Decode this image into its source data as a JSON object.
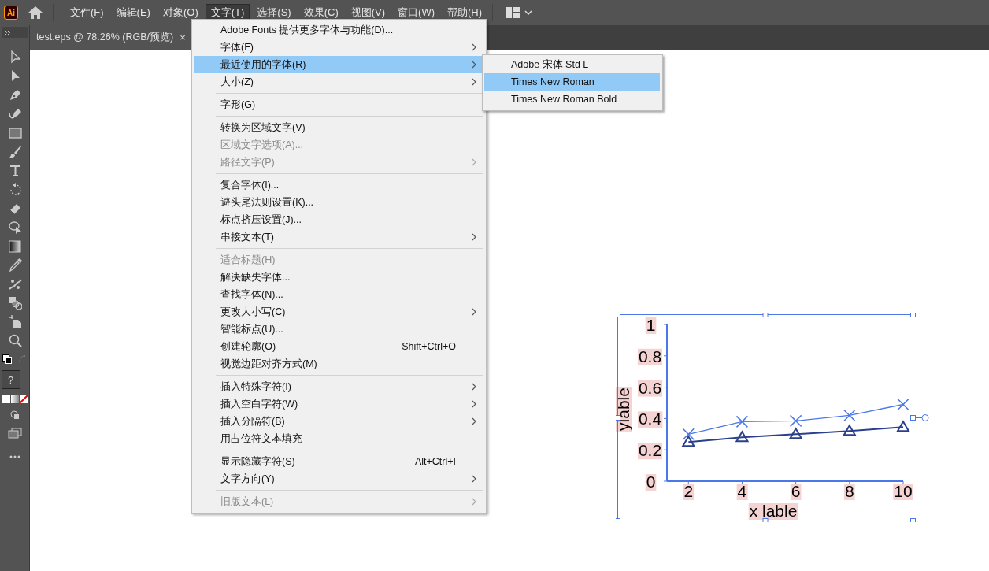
{
  "app": {
    "logo": "Ai"
  },
  "menubar": [
    {
      "label": "文件(F)",
      "selected": false
    },
    {
      "label": "编辑(E)",
      "selected": false
    },
    {
      "label": "对象(O)",
      "selected": false
    },
    {
      "label": "文字(T)",
      "selected": true
    },
    {
      "label": "选择(S)",
      "selected": false
    },
    {
      "label": "效果(C)",
      "selected": false
    },
    {
      "label": "视图(V)",
      "selected": false
    },
    {
      "label": "窗口(W)",
      "selected": false
    },
    {
      "label": "帮助(H)",
      "selected": false
    }
  ],
  "document_tab": {
    "title": "test.eps @ 78.26% (RGB/预览)",
    "close": "×"
  },
  "toolbar": {
    "help_box": "?"
  },
  "type_menu": {
    "items": [
      {
        "kind": "item",
        "label": "Adobe Fonts 提供更多字体与功能(D)...",
        "submenu": false,
        "disabled": false,
        "selected": false
      },
      {
        "kind": "item",
        "label": "字体(F)",
        "submenu": true,
        "disabled": false,
        "selected": false
      },
      {
        "kind": "item",
        "label": "最近使用的字体(R)",
        "submenu": true,
        "disabled": false,
        "selected": true
      },
      {
        "kind": "item",
        "label": "大小(Z)",
        "submenu": true,
        "disabled": false,
        "selected": false
      },
      {
        "kind": "separator"
      },
      {
        "kind": "item",
        "label": "字形(G)",
        "submenu": false,
        "disabled": false,
        "selected": false
      },
      {
        "kind": "separator"
      },
      {
        "kind": "item",
        "label": "转换为区域文字(V)",
        "submenu": false,
        "disabled": false,
        "selected": false
      },
      {
        "kind": "item",
        "label": "区域文字选项(A)...",
        "submenu": false,
        "disabled": true,
        "selected": false
      },
      {
        "kind": "item",
        "label": "路径文字(P)",
        "submenu": true,
        "disabled": true,
        "selected": false
      },
      {
        "kind": "separator"
      },
      {
        "kind": "item",
        "label": "复合字体(I)...",
        "submenu": false,
        "disabled": false,
        "selected": false
      },
      {
        "kind": "item",
        "label": "避头尾法则设置(K)...",
        "submenu": false,
        "disabled": false,
        "selected": false
      },
      {
        "kind": "item",
        "label": "标点挤压设置(J)...",
        "submenu": false,
        "disabled": false,
        "selected": false
      },
      {
        "kind": "item",
        "label": "串接文本(T)",
        "submenu": true,
        "disabled": false,
        "selected": false
      },
      {
        "kind": "separator"
      },
      {
        "kind": "item",
        "label": "适合标题(H)",
        "submenu": false,
        "disabled": true,
        "selected": false
      },
      {
        "kind": "item",
        "label": "解决缺失字体...",
        "submenu": false,
        "disabled": false,
        "selected": false
      },
      {
        "kind": "item",
        "label": "查找字体(N)...",
        "submenu": false,
        "disabled": false,
        "selected": false
      },
      {
        "kind": "item",
        "label": "更改大小写(C)",
        "submenu": true,
        "disabled": false,
        "selected": false
      },
      {
        "kind": "item",
        "label": "智能标点(U)...",
        "submenu": false,
        "disabled": false,
        "selected": false
      },
      {
        "kind": "item",
        "label": "创建轮廓(O)",
        "shortcut": "Shift+Ctrl+O",
        "submenu": false,
        "disabled": false,
        "selected": false
      },
      {
        "kind": "item",
        "label": "视觉边距对齐方式(M)",
        "submenu": false,
        "disabled": false,
        "selected": false
      },
      {
        "kind": "separator"
      },
      {
        "kind": "item",
        "label": "插入特殊字符(I)",
        "submenu": true,
        "disabled": false,
        "selected": false
      },
      {
        "kind": "item",
        "label": "插入空白字符(W)",
        "submenu": true,
        "disabled": false,
        "selected": false
      },
      {
        "kind": "item",
        "label": "插入分隔符(B)",
        "submenu": true,
        "disabled": false,
        "selected": false
      },
      {
        "kind": "item",
        "label": "用占位符文本填充",
        "submenu": false,
        "disabled": false,
        "selected": false
      },
      {
        "kind": "separator"
      },
      {
        "kind": "item",
        "label": "显示隐藏字符(S)",
        "shortcut": "Alt+Ctrl+I",
        "submenu": false,
        "disabled": false,
        "selected": false
      },
      {
        "kind": "item",
        "label": "文字方向(Y)",
        "submenu": true,
        "disabled": false,
        "selected": false
      },
      {
        "kind": "separator"
      },
      {
        "kind": "item",
        "label": "旧版文本(L)",
        "submenu": true,
        "disabled": true,
        "selected": false
      }
    ]
  },
  "recent_fonts_submenu": {
    "items": [
      {
        "label": "Adobe 宋体 Std L",
        "selected": false
      },
      {
        "label": "Times New Roman",
        "selected": true
      },
      {
        "label": "Times New Roman Bold",
        "selected": false
      }
    ]
  },
  "artboard": {
    "chart_data": {
      "type": "line",
      "xlabel": "x lable",
      "ylabel": "ylable",
      "x": [
        2,
        4,
        6,
        8,
        10
      ],
      "series": [
        {
          "color": "#4a78e8",
          "marker": "x",
          "values": [
            0.3,
            0.38,
            0.385,
            0.42,
            0.49
          ]
        },
        {
          "color": "#2b3f8c",
          "marker": "triangle",
          "values": [
            0.25,
            0.28,
            0.3,
            0.32,
            0.345
          ]
        }
      ],
      "xlim": [
        1.2,
        10
      ],
      "ylim": [
        0,
        1
      ],
      "xticks": [
        2,
        4,
        6,
        8,
        10
      ],
      "yticks": [
        {
          "value": 0,
          "label": "0"
        },
        {
          "value": 0.2,
          "label": "0.2"
        },
        {
          "value": 0.4,
          "label": "0.4"
        },
        {
          "value": 0.6,
          "label": "0.6"
        },
        {
          "value": 0.8,
          "label": "0.8"
        },
        {
          "value": 1,
          "label": "1"
        }
      ]
    }
  }
}
